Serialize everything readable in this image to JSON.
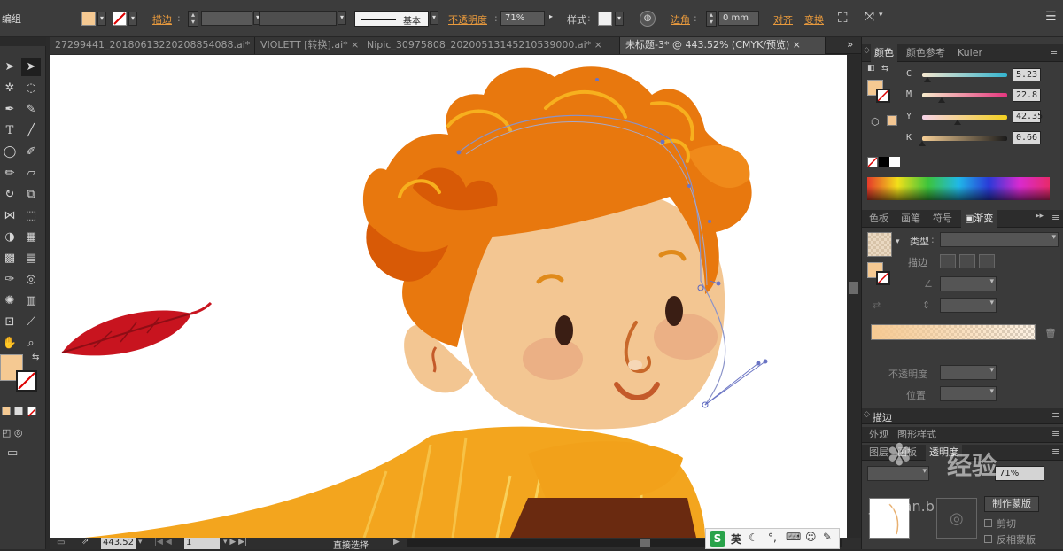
{
  "ctrl": {
    "mode_label": "编组",
    "stroke_label": "描边",
    "brush_label": "基本",
    "opacity_label": "不透明度",
    "opacity_value": "71%",
    "style_label": "样式",
    "corner_label": "边角",
    "corner_value": "0 mm",
    "align_label": "对齐",
    "transform_label": "变换",
    "fill_color": "#f5c992"
  },
  "tabs": [
    {
      "label": "27299441_20180613220208854088.ai*",
      "close": "×"
    },
    {
      "label": "VIOLETT [转换].ai*",
      "close": "×"
    },
    {
      "label": "Nipic_30975808_20200513145210539000.ai*",
      "close": "×"
    },
    {
      "label": "未标题-3* @ 443.52% (CMYK/预览)",
      "close": "×"
    }
  ],
  "tabs_more": "»",
  "color_panel": {
    "tabs": [
      "颜色",
      "颜色参考",
      "Kuler"
    ],
    "channels": [
      {
        "name": "C",
        "value": "5.23",
        "fraction": 0.05
      },
      {
        "name": "M",
        "value": "22.8",
        "fraction": 0.23
      },
      {
        "name": "Y",
        "value": "42.35",
        "fraction": 0.42
      },
      {
        "name": "K",
        "value": "0.66",
        "fraction": 0.01
      }
    ]
  },
  "gradient_panel": {
    "tabs": [
      "色板",
      "画笔",
      "符号",
      "渐变"
    ],
    "type_label": "类型",
    "stroke_label": "描边",
    "opacity_label": "不透明度",
    "position_label": "位置"
  },
  "stroke_panel": {
    "title": "描边"
  },
  "appearance_panel": {
    "tabs": [
      "外观",
      "图形样式"
    ],
    "sub_tabs": [
      "图层",
      "画板",
      "透明度"
    ],
    "opacity_value": "71%",
    "make_mask": "制作蒙版",
    "clip": "剪切",
    "invert_mask": "反相蒙版"
  },
  "status": {
    "zoom": "443.52",
    "page": "1",
    "tool": "直接选择"
  },
  "ime": {
    "lang": "英"
  },
  "watermark": {
    "text": "经验",
    "sub": "jingyan.b"
  },
  "colors": {
    "hair": "#e8780e",
    "hair_dark": "#d85a06",
    "hair_light": "#f7b01e",
    "skin": "#f3c692",
    "skin_shade": "#e7ae78",
    "cheek": "#ebb085",
    "sweater": "#f3a51e",
    "leaf": "#c8141f"
  }
}
